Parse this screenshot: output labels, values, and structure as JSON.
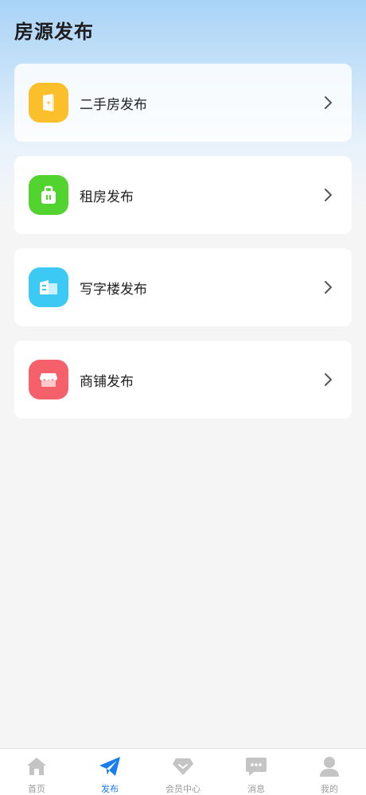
{
  "page": {
    "title": "房源发布"
  },
  "colors": {
    "accent": "#1a7ef2",
    "tab_inactive": "#c4c4c4",
    "icon_secondhand": "#fbbf2c",
    "icon_rent": "#53d32f",
    "icon_office": "#3cc9f3",
    "icon_shop": "#f5616a"
  },
  "menu": {
    "items": [
      {
        "label": "二手房发布",
        "icon": "door-icon"
      },
      {
        "label": "租房发布",
        "icon": "bag-icon"
      },
      {
        "label": "写字楼发布",
        "icon": "building-icon"
      },
      {
        "label": "商铺发布",
        "icon": "shop-icon"
      }
    ]
  },
  "tabbar": {
    "items": [
      {
        "label": "首页",
        "icon": "home-icon",
        "active": false
      },
      {
        "label": "发布",
        "icon": "paper-plane-icon",
        "active": true
      },
      {
        "label": "会员中心",
        "icon": "diamond-icon",
        "active": false
      },
      {
        "label": "消息",
        "icon": "message-icon",
        "active": false
      },
      {
        "label": "我的",
        "icon": "user-icon",
        "active": false
      }
    ]
  }
}
